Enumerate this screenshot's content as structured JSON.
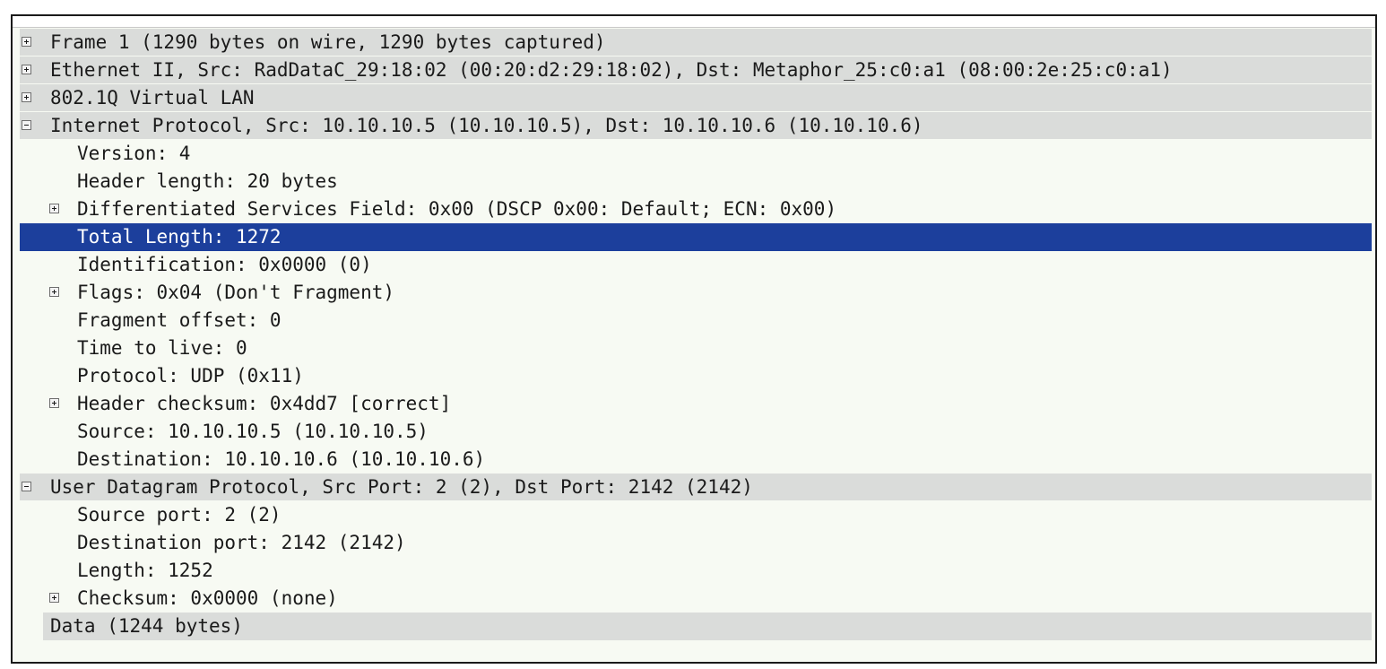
{
  "packet_details": {
    "rows": [
      {
        "label": "Frame 1 (1290 bytes on wire, 1290 bytes captured)"
      },
      {
        "label": "Ethernet II, Src: RadDataC_29:18:02 (00:20:d2:29:18:02), Dst: Metaphor_25:c0:a1 (08:00:2e:25:c0:a1)"
      },
      {
        "label": "802.1Q Virtual LAN"
      },
      {
        "label": "Internet Protocol, Src: 10.10.10.5 (10.10.10.5), Dst: 10.10.10.6 (10.10.10.6)"
      },
      {
        "label": "Version: 4"
      },
      {
        "label": "Header length: 20 bytes"
      },
      {
        "label": "Differentiated Services Field: 0x00 (DSCP 0x00: Default; ECN: 0x00)"
      },
      {
        "label": "Total Length: 1272"
      },
      {
        "label": "Identification: 0x0000 (0)"
      },
      {
        "label": "Flags: 0x04 (Don't Fragment)"
      },
      {
        "label": "Fragment offset: 0"
      },
      {
        "label": "Time to live: 0"
      },
      {
        "label": "Protocol: UDP (0x11)"
      },
      {
        "label": "Header checksum: 0x4dd7 [correct]"
      },
      {
        "label": "Source: 10.10.10.5 (10.10.10.5)"
      },
      {
        "label": "Destination: 10.10.10.6 (10.10.10.6)"
      },
      {
        "label": "User Datagram Protocol, Src Port: 2 (2), Dst Port: 2142 (2142)"
      },
      {
        "label": "Source port: 2 (2)"
      },
      {
        "label": "Destination port: 2142 (2142)"
      },
      {
        "label": "Length: 1252"
      },
      {
        "label": "Checksum: 0x0000 (none)"
      },
      {
        "label": "Data (1244 bytes)"
      }
    ]
  },
  "colors": {
    "selected_row": "#1c3f9c",
    "top_level_row": "#dadcda",
    "pane_background": "#f7faf3"
  },
  "icons": {
    "collapsed": "plus-expander-icon",
    "expanded": "minus-expander-icon"
  }
}
